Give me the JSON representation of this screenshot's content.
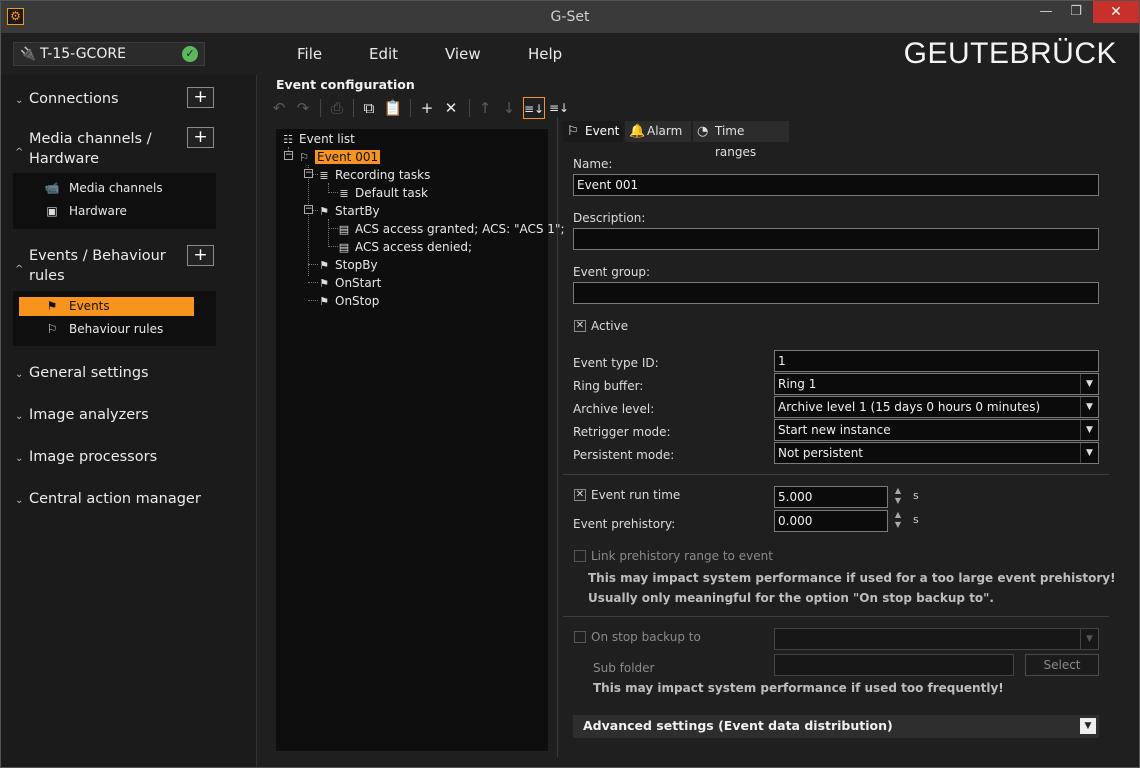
{
  "window": {
    "title": "G-Set",
    "minimize": "—",
    "maximize": "❐",
    "close": "✕",
    "app_icon": "⚙"
  },
  "connection": {
    "name": "T-15-GCORE",
    "plug_icon": "🔌",
    "ok_icon": "✓"
  },
  "menu": {
    "file": "File",
    "edit": "Edit",
    "view": "View",
    "help": "Help"
  },
  "brand": {
    "logo": "GEUTEBRÜCK"
  },
  "sidebar": {
    "connections": "Connections",
    "media_hw_1": "Media channels /",
    "media_hw_2": "Hardware",
    "media_channels": "Media channels",
    "hardware": "Hardware",
    "events_1": "Events / Behaviour",
    "events_2": "rules",
    "events": "Events",
    "behaviour_rules": "Behaviour rules",
    "general_settings": "General settings",
    "image_analyzers": "Image analyzers",
    "image_processors": "Image processors",
    "central_action_manager": "Central action manager",
    "add": "+",
    "chev_right": "⌄",
    "chev_up": "^"
  },
  "center": {
    "title": "Event configuration",
    "toolbar": {
      "undo": "↶",
      "redo": "↷",
      "print": "⎙",
      "copy": "⧉",
      "paste": "📋",
      "new": "+",
      "delete": "✕",
      "up": "↑",
      "down": "↓",
      "sort1": "≡↓",
      "sort2": "≡↓"
    },
    "tree": {
      "root": "Event list",
      "event": "Event 001",
      "recording_tasks": "Recording tasks",
      "default_task": "Default task",
      "start_by": "StartBy",
      "acs_granted": "ACS access granted; ACS: \"ACS 1\";",
      "acs_denied": "ACS access denied;",
      "stop_by": "StopBy",
      "on_start": "OnStart",
      "on_stop": "OnStop"
    }
  },
  "tabs": {
    "event": "Event",
    "alarm": "Alarm",
    "time_ranges": "Time ranges"
  },
  "form": {
    "name_label": "Name:",
    "name_value": "Event 001",
    "description_label": "Description:",
    "description_value": "",
    "event_group_label": "Event group:",
    "event_group_value": "",
    "active_label": "Active",
    "active_checked": "✕",
    "event_type_id_label": "Event type ID:",
    "event_type_id_value": "1",
    "ring_buffer_label": "Ring buffer:",
    "ring_buffer_value": "Ring 1",
    "archive_level_label": "Archive level:",
    "archive_level_value": "Archive level 1 (15 days 0 hours 0 minutes)",
    "retrigger_label": "Retrigger mode:",
    "retrigger_value": "Start new instance",
    "persistent_label": "Persistent mode:",
    "persistent_value": "Not persistent",
    "event_run_time_label": "Event run time",
    "event_run_time_value": "5.000",
    "event_prehistory_label": "Event prehistory:",
    "event_prehistory_value": "0.000",
    "unit_s": "s",
    "link_prehistory_label": "Link prehistory range to event",
    "warn_prehistory_1": "This may impact system performance if used for a too large event prehistory!",
    "warn_prehistory_2": "Usually only meaningful for the option \"On stop backup to\".",
    "on_stop_backup_label": "On stop backup to",
    "on_stop_backup_value": "",
    "sub_folder_label": "Sub folder",
    "sub_folder_value": "",
    "select_button": "Select",
    "warn_backup": "This may impact system performance if used too frequently!",
    "advanced": "Advanced settings (Event data distribution)",
    "dropdown_arrow": "▼",
    "spin_up": "▲",
    "spin_down": "▼"
  },
  "colors": {
    "accent": "#f7941d",
    "ok": "#5cb85c",
    "close": "#c7302b"
  }
}
